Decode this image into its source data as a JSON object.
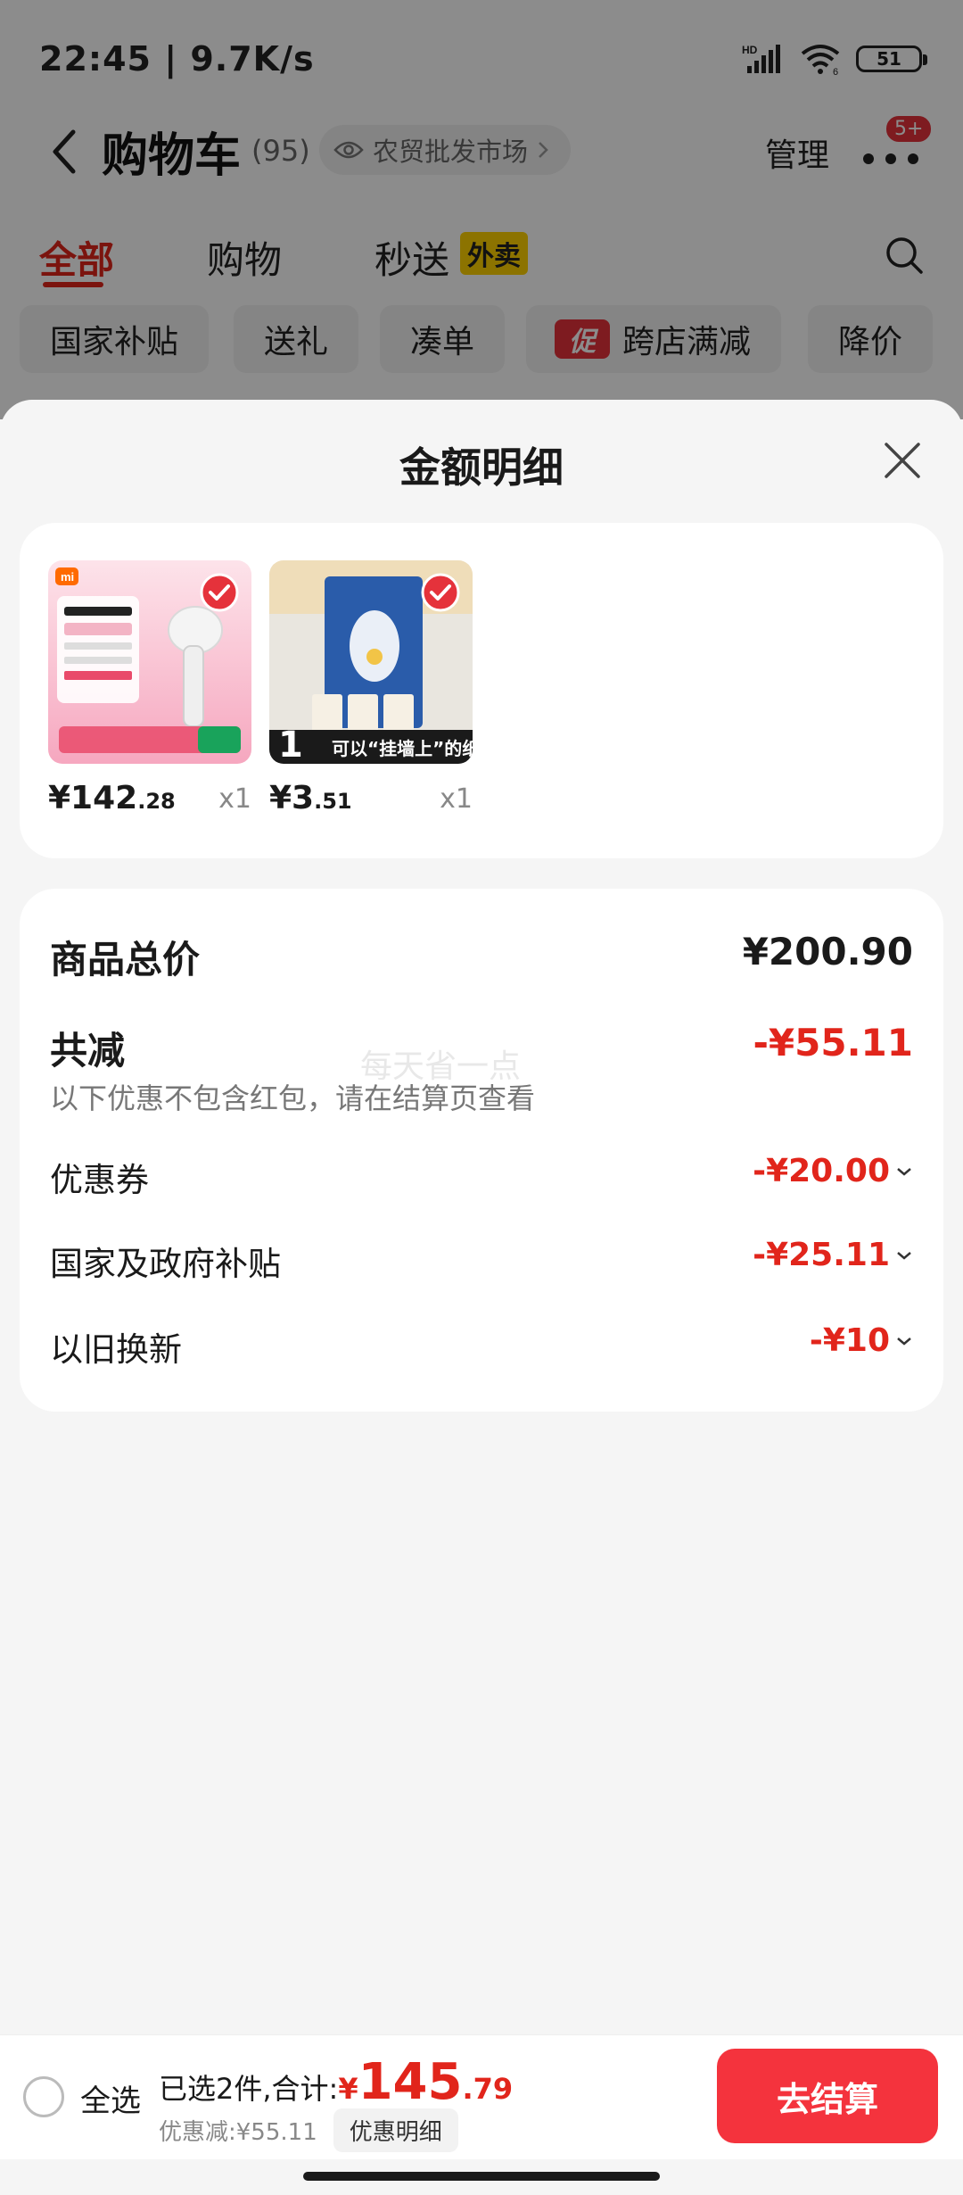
{
  "status_bar": {
    "time": "22:45",
    "speed": "9.7K/s",
    "network": "HD",
    "wifi_label": "6",
    "battery": "51"
  },
  "nav": {
    "title": "购物车",
    "count": "(95)",
    "market": "农贸批发市场",
    "manage": "管理",
    "badge": "5+"
  },
  "tabs": [
    {
      "label": "全部",
      "active": true
    },
    {
      "label": "购物"
    },
    {
      "label": "秒送"
    }
  ],
  "tab_badge": "外卖",
  "filters": [
    "国家补贴",
    "送礼",
    "凑单",
    "跨店满减",
    "降价"
  ],
  "promo_tag": "促",
  "sheet": {
    "title": "金额明细",
    "products": [
      {
        "price_int": "¥142",
        "price_dec": ".28",
        "qty": "x1",
        "image": "hair-dryer-product-image",
        "brand": "mi"
      },
      {
        "price_int": "¥3",
        "price_dec": ".51",
        "qty": "x1",
        "image": "tissue-box-product-image",
        "caption": "可以“挂墙上”的纸",
        "count_mark": "1"
      }
    ],
    "summary": {
      "total_label": "商品总价",
      "total_value": "¥200.90",
      "reduce_label": "共减",
      "reduce_value": "-¥55.11",
      "note": "以下优惠不包含红包，请在结算页查看",
      "watermark": "每天省一点",
      "items": [
        {
          "label": "优惠券",
          "value": "-¥20.00"
        },
        {
          "label": "国家及政府补贴",
          "value": "-¥25.11"
        },
        {
          "label": "以旧换新",
          "value": "-¥10"
        }
      ]
    }
  },
  "bottom": {
    "select_all": "全选",
    "selected_label": "已选2件,合计:",
    "currency": "¥",
    "total_int": "145",
    "total_dec": ".79",
    "discount": "优惠减:¥55.11",
    "detail": "优惠明细",
    "checkout": "去结算"
  },
  "colors": {
    "accent": "#e1251b",
    "checkout": "#f4333d",
    "tab_badge": "#ffd200"
  }
}
